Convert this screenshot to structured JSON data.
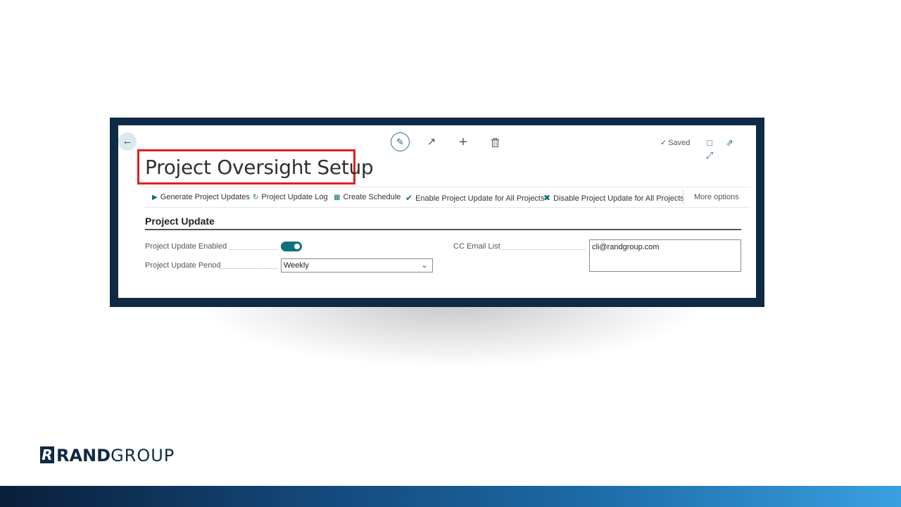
{
  "header": {
    "title": "Project Oversight Setup",
    "saved_status": "Saved"
  },
  "actions": [
    {
      "label": "Generate Project Updates",
      "icon": "play-icon"
    },
    {
      "label": "Project Update Log",
      "icon": "history-icon"
    },
    {
      "label": "Create Schedule",
      "icon": "calendar-icon"
    },
    {
      "label": "Enable Project Update for All Projects",
      "icon": "check-icon"
    },
    {
      "label": "Disable Project Update for All Projects",
      "icon": "close-icon"
    },
    {
      "label": "More options"
    }
  ],
  "section": {
    "title": "Project Update",
    "fields": {
      "enabled_label": "Project Update Enabled",
      "enabled_value": true,
      "period_label": "Project Update Period",
      "period_value": "Weekly",
      "cc_label": "CC Email List",
      "cc_value": "cli@randgroup.com"
    }
  },
  "branding": {
    "logo_mark": "R",
    "logo_word_bold": "RAND",
    "logo_word_light": "GROUP"
  },
  "colors": {
    "frame": "#0f2a45",
    "accent": "#0f6f7a",
    "highlight": "#e02020"
  }
}
